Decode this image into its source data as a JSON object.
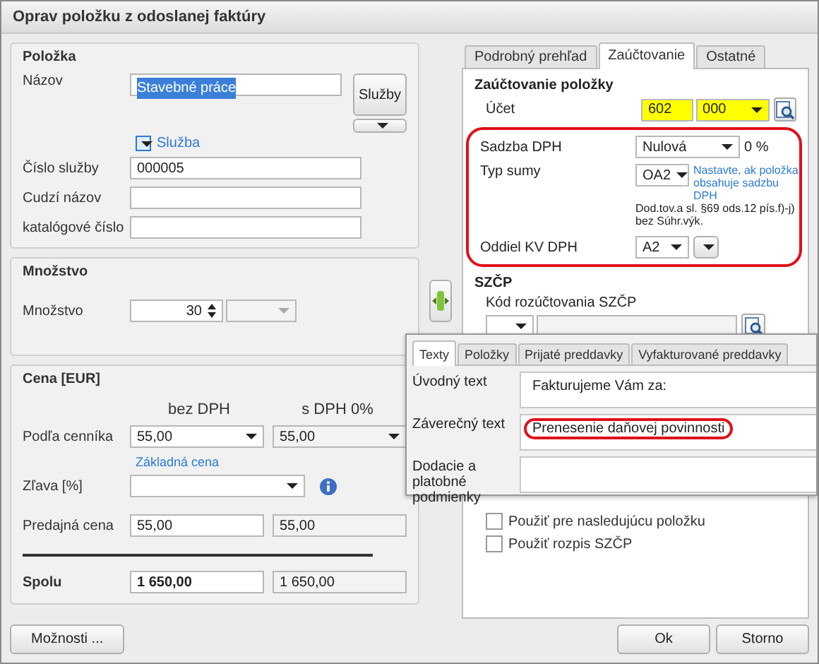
{
  "window": {
    "title": "Oprav položku z odoslanej faktúry"
  },
  "item": {
    "title": "Položka",
    "name_label": "Názov",
    "name_value": "Stavebné práce",
    "name_selected": true,
    "services_button": "Služby",
    "service_toggle": "Služba",
    "fields": [
      {
        "label": "Číslo služby",
        "value": "000005"
      },
      {
        "label": "Cudzí názov"
      },
      {
        "label": "katalógové číslo"
      }
    ]
  },
  "quantity": {
    "title": "Množstvo",
    "label": "Množstvo",
    "value": "30"
  },
  "price": {
    "title": "Cena [EUR]",
    "columns": [
      "bez DPH",
      "s DPH 0%"
    ],
    "rows": [
      {
        "kind": "combo",
        "label": "Podľa cenníka",
        "net": "55,00",
        "gross": "55,00",
        "link": "Základná cena"
      },
      {
        "kind": "discount",
        "label": "Zľava [%]"
      },
      {
        "kind": "plain",
        "label": "Predajná cena",
        "net": "55,00",
        "gross": "55,00"
      }
    ],
    "total": {
      "label": "Spolu",
      "net": "1 650,00",
      "gross": "1 650,00"
    }
  },
  "tabs": [
    {
      "label": "Podrobný prehľad",
      "selected": false
    },
    {
      "label": "Zaúčtovanie",
      "selected": true
    },
    {
      "label": "Ostatné",
      "selected": false
    }
  ],
  "posting": {
    "title": "Zaúčtovanie položky",
    "account_label": "Účet",
    "account": "602",
    "analytic": "000",
    "highlighted": true,
    "vat_rate_label": "Sadzba DPH",
    "vat_rate": "Nulová",
    "vat_percent": "0 %",
    "sum_type_label": "Typ sumy",
    "sum_type": "OA2",
    "sum_type_hint": "Nastavte, ak položka obsahuje sadzbu DPH",
    "sum_type_desc": "Dod.tov.a sl. §69 ods.12 pís.f)-j) bez Súhr.výk.",
    "kv_label": "Oddiel KV DPH",
    "kv": "A2"
  },
  "szcp": {
    "title": "SZČP",
    "code_label": "Kód rozúčtovania SZČP",
    "checkboxes": [
      {
        "label": "Použiť pre nasledujúcu položku",
        "checked": false
      },
      {
        "label": "Použiť rozpis SZČP",
        "checked": false
      }
    ]
  },
  "texts": {
    "tabs": [
      {
        "label": "Texty",
        "selected": true
      },
      {
        "label": "Položky",
        "selected": false
      },
      {
        "label": "Prijaté preddavky",
        "selected": false
      },
      {
        "label": "Vyfakturované preddavky",
        "selected": false
      }
    ],
    "fields": [
      {
        "label": "Úvodný text",
        "value": "Fakturujeme Vám za:"
      },
      {
        "label": "Záverečný text",
        "value": "Prenesenie daňovej povinnosti",
        "highlighted": true
      },
      {
        "label": "Dodacie a platobné podmienky"
      }
    ]
  },
  "buttons": {
    "options": "Možnosti ...",
    "ok": "Ok",
    "cancel": "Storno"
  }
}
